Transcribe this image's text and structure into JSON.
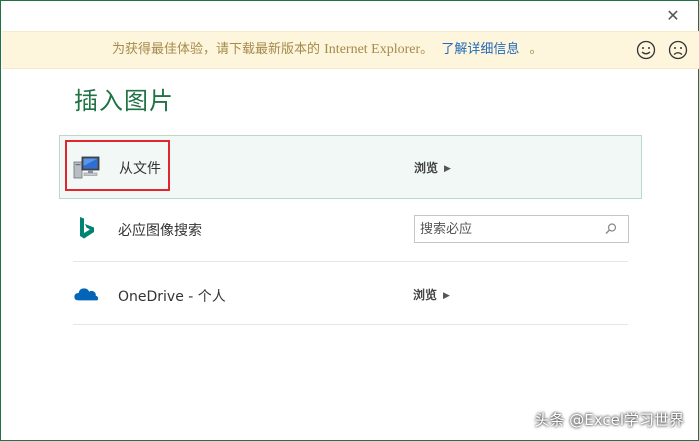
{
  "dialog": {
    "close_glyph": "✕"
  },
  "banner": {
    "message": "为获得最佳体验，请下载最新版本的 ",
    "browser": "Internet Explorer",
    "punct": "。",
    "link_text": "了解详细信息",
    "trailing": "。",
    "icons": [
      "smiley-happy-icon",
      "smiley-sad-icon"
    ]
  },
  "title": "插入图片",
  "rows": {
    "from_file": {
      "label": "从文件",
      "action": "浏览",
      "icon": "computer-icon"
    },
    "bing": {
      "label": "必应图像搜索",
      "search_placeholder": "搜索必应",
      "icon": "bing-icon"
    },
    "onedrive": {
      "label": "OneDrive - 个人",
      "action": "浏览",
      "icon": "cloud-icon"
    }
  },
  "watermark": "头条 @Excel学习世界",
  "colors": {
    "accent": "#217346",
    "banner_bg": "#fdf6dd",
    "link": "#2368b8",
    "highlight": "#e0262f",
    "bing": "#008373",
    "onedrive": "#0364b8"
  }
}
